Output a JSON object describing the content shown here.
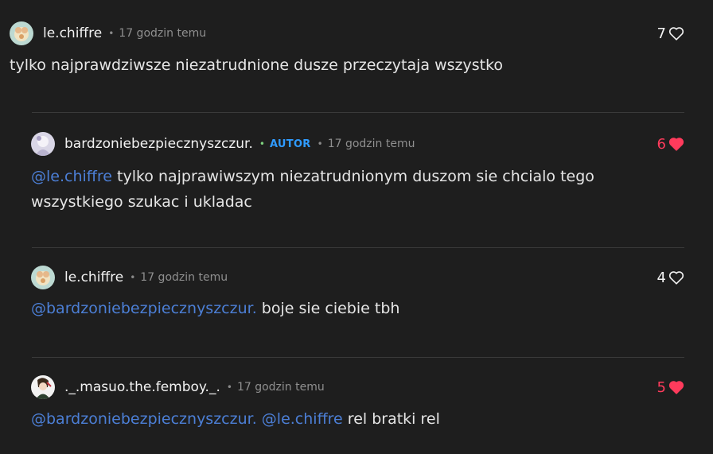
{
  "comments": [
    {
      "username": "le.chiffre",
      "time": "17 godzin temu",
      "likes": "7",
      "liked": false,
      "text": "tylko najprawdziwsze niezatrudnione dusze przeczytaja wszystko"
    },
    {
      "username": "bardzoniebezpiecznyszczur.",
      "badge": "AUTOR",
      "time": "17 godzin temu",
      "likes": "6",
      "liked": true,
      "mentions": [
        "@le.chiffre"
      ],
      "text": "tylko najprawiwszym niezatrudnionym duszom sie chcialo tego wszystkiego szukac i ukladac"
    },
    {
      "username": "le.chiffre",
      "time": "17 godzin temu",
      "likes": "4",
      "liked": false,
      "mentions": [
        "@bardzoniebezpiecznyszczur."
      ],
      "text": "boje sie ciebie tbh"
    },
    {
      "username": "._.masuo.the.femboy._.",
      "time": "17 godzin temu",
      "likes": "5",
      "liked": true,
      "mentions": [
        "@bardzoniebezpiecznyszczur.",
        "@le.chiffre"
      ],
      "text": "rel bratki rel"
    }
  ],
  "separator": "•",
  "colors": {
    "background": "#1e1e1e",
    "mention": "#4c7fd6",
    "author_badge": "#2f9bff",
    "liked_heart": "#ff3b5c"
  },
  "icons": {
    "like": "heart-outline-icon",
    "liked": "heart-filled-icon"
  }
}
